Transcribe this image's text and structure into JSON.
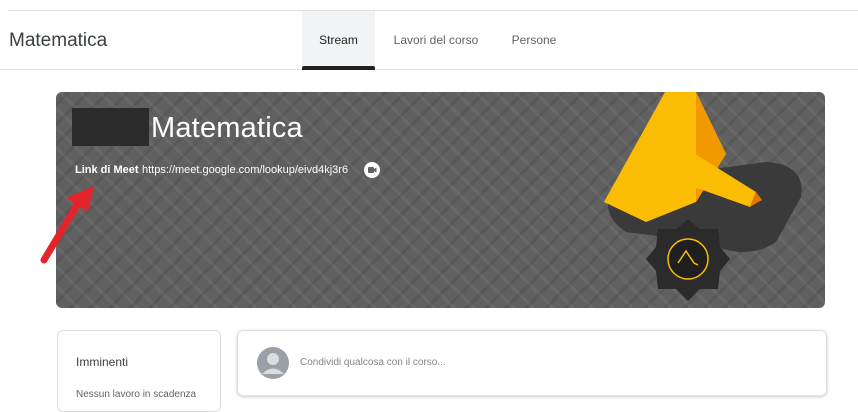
{
  "header": {
    "course_title": "Matematica",
    "tabs": [
      {
        "label": "Stream",
        "active": true
      },
      {
        "label": "Lavori del corso",
        "active": false
      },
      {
        "label": "Persone",
        "active": false
      }
    ]
  },
  "banner": {
    "title": "Matematica",
    "meet_label": "Link di Meet",
    "meet_link": "https://meet.google.com/lookup/eivd4kj3r6",
    "icons": {
      "meet": "meet-camera-icon",
      "illustration": "flashlight-illustration"
    },
    "colors": {
      "background": "#606060",
      "accent": "#fbbc04",
      "dark": "#2b2b2b"
    }
  },
  "annotation": {
    "icon": "red-arrow-icon",
    "color": "#e5232a"
  },
  "upcoming": {
    "title": "Imminenti",
    "empty_text": "Nessun lavoro in scadenza"
  },
  "share": {
    "placeholder": "Condividi qualcosa con il corso..."
  }
}
